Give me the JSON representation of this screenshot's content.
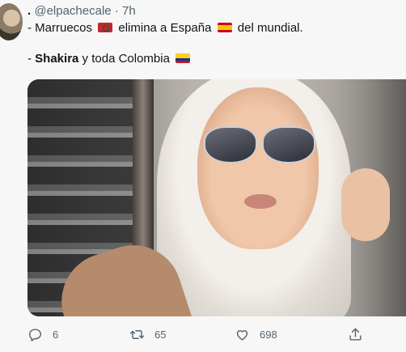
{
  "tweet": {
    "handle": "@elpachecale",
    "separator": "·",
    "time": "7h",
    "line1": {
      "dash": "- ",
      "subject": "Marruecos",
      "verb": "elimina a España",
      "rest": "del mundial."
    },
    "line2": {
      "dash": "- ",
      "name": "Shakira",
      "rest": "y toda Colombia"
    }
  },
  "actions": {
    "reply_count": "6",
    "retweet_count": "65",
    "like_count": "698"
  },
  "icons": [
    "avatar",
    "morocco-flag-icon",
    "spain-flag-icon",
    "colombia-flag-icon",
    "reply-icon",
    "retweet-icon",
    "like-icon",
    "share-icon"
  ],
  "colors": {
    "text": "#0f1419",
    "muted": "#536471",
    "background": "#f7f7f7"
  }
}
